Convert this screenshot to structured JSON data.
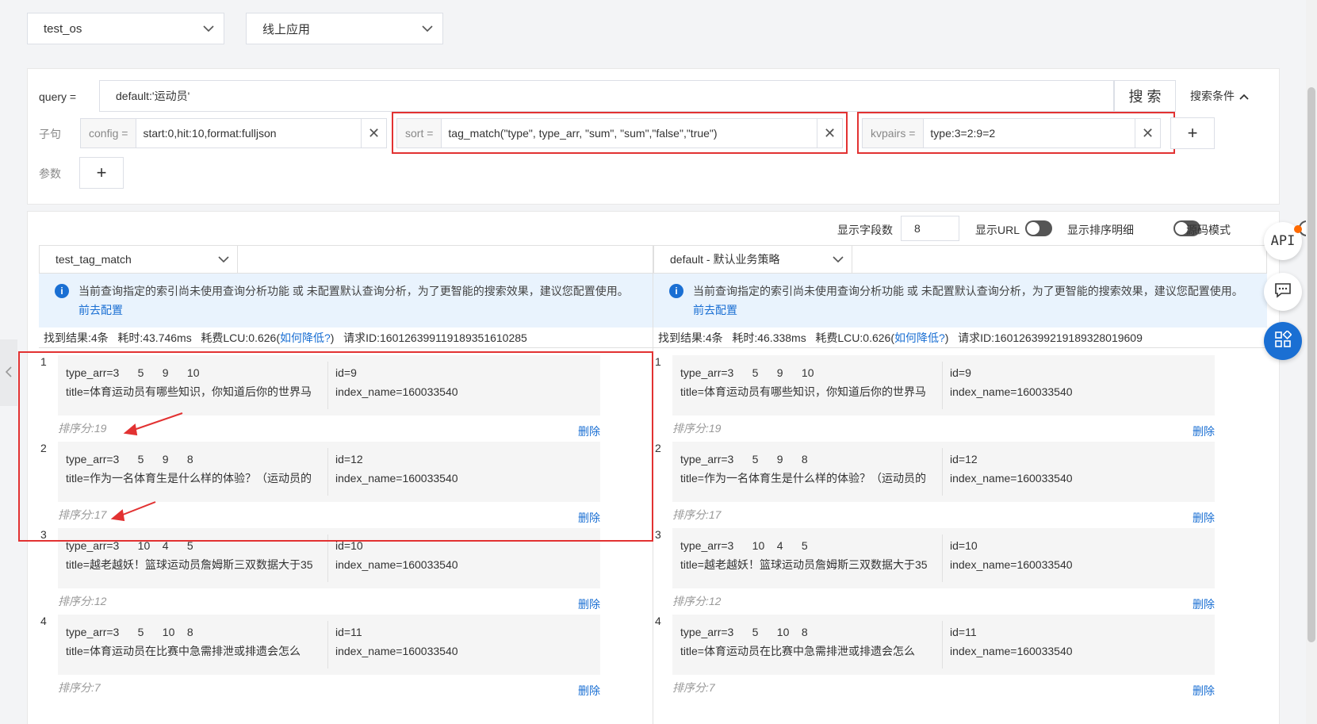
{
  "top": {
    "select_os": "test_os",
    "select_app": "线上应用"
  },
  "search": {
    "query_label": "query =",
    "query_value": "default:'运动员'",
    "search_button": "搜 索",
    "conditions_label": "搜索条件",
    "clause_label": "子句",
    "params_label": "参数",
    "config_prefix": "config =",
    "config_value": "start:0,hit:10,format:fulljson",
    "sort_prefix": "sort =",
    "sort_value": "tag_match(\"type\", type_arr, \"sum\", \"sum\",\"false\",\"true\")",
    "kvpairs_prefix": "kvpairs =",
    "kvpairs_value": "type:3=2:9=2",
    "plus": "+",
    "clear": "✕"
  },
  "options": {
    "field_count_label": "显示字段数",
    "field_count_value": "8",
    "show_url_label": "显示URL",
    "show_sort_detail_label": "显示排序明细",
    "source_mode_label": "源码模式"
  },
  "left": {
    "strategy": "test_tag_match",
    "notice": "当前查询指定的索引尚未使用查询分析功能 或 未配置默认查询分析，为了更智能的搜索效果，建议您配置使用。",
    "notice_link": "前去配置",
    "stats_prefix": "找到结果:4条   耗时:43.746ms   耗费LCU:0.626(",
    "stats_link": "如何降低?",
    "stats_suffix": ")   请求ID:160126399119189351610285"
  },
  "right": {
    "strategy": "default - 默认业务策略",
    "notice": "当前查询指定的索引尚未使用查询分析功能 或 未配置默认查询分析，为了更智能的搜索效果，建议您配置使用。",
    "notice_link": "前去配置",
    "stats_prefix": "找到结果:4条   耗时:46.338ms   耗费LCU:0.626(",
    "stats_link": "如何降低?",
    "stats_suffix": ")   请求ID:160126399219189328019609"
  },
  "results": [
    {
      "idx": "1",
      "type_arr": "type_arr=3      5      9      10",
      "title": "title=体育运动员有哪些知识，你知道后你的世界马",
      "id": "id=9",
      "index_name": "index_name=160033540",
      "score": "排序分:19",
      "delete": "删除"
    },
    {
      "idx": "2",
      "type_arr": "type_arr=3      5      9      8",
      "title": "title=作为一名体育生是什么样的体验？（运动员的",
      "id": "id=12",
      "index_name": "index_name=160033540",
      "score": "排序分:17",
      "delete": "删除"
    },
    {
      "idx": "3",
      "type_arr": "type_arr=3      10    4      5",
      "title": "title=越老越妖！篮球运动员詹姆斯三双数据大于35",
      "id": "id=10",
      "index_name": "index_name=160033540",
      "score": "排序分:12",
      "delete": "删除"
    },
    {
      "idx": "4",
      "type_arr": "type_arr=3      5      10    8",
      "title": "title=体育运动员在比赛中急需排泄或排遗会怎么",
      "id": "id=11",
      "index_name": "index_name=160033540",
      "score": "排序分:7",
      "delete": "删除"
    }
  ],
  "sidebar": {
    "api_label": "API"
  },
  "colors": {
    "accent": "#1a6fd3",
    "annotation_red": "#e23232",
    "badge_orange": "#ff6a00"
  }
}
